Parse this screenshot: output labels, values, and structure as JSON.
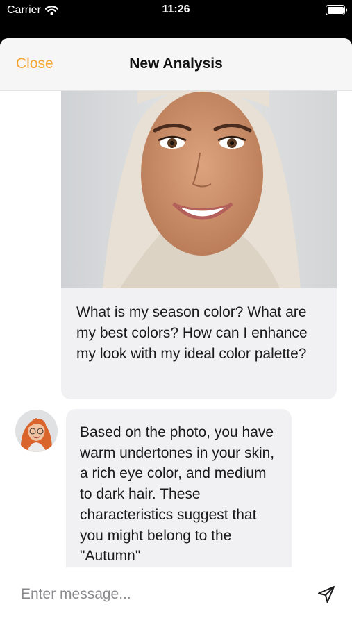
{
  "status_bar": {
    "carrier": "Carrier",
    "time": "11:26"
  },
  "nav": {
    "close_label": "Close",
    "title": "New Analysis"
  },
  "chat": {
    "user_message": "What is my season color? What are my best colors? How can I enhance my look with my ideal color palette?",
    "assistant_message": "Based on the photo, you have warm undertones in your skin, a rich eye color, and medium to dark hair. These characteristics suggest that you might belong to the \"Autumn\""
  },
  "composer": {
    "placeholder": "Enter message..."
  },
  "colors": {
    "accent": "#f5a52f",
    "bubble": "#f1f1f3"
  },
  "icons": {
    "wifi": "wifi-icon",
    "battery": "battery-icon",
    "send": "send-icon",
    "avatar": "assistant-avatar"
  }
}
